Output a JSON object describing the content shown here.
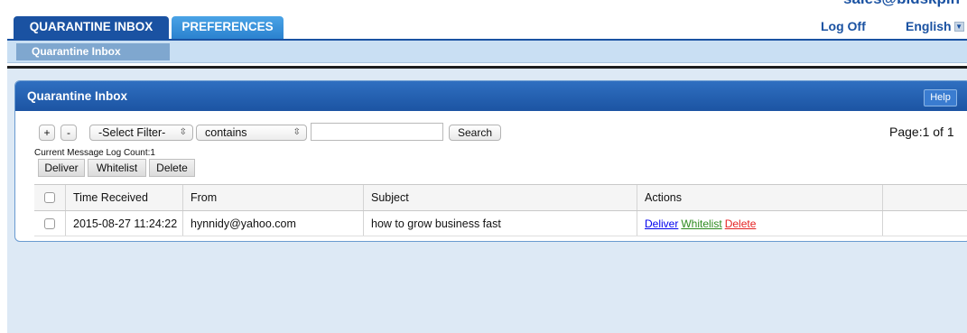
{
  "header": {
    "tabs": [
      {
        "label": "QUARANTINE INBOX",
        "active": true
      },
      {
        "label": "PREFERENCES",
        "active": false
      }
    ],
    "account_partial": "sales@bidskpin",
    "logoff_label": "Log Off",
    "language": "English"
  },
  "subnav": {
    "tab_label": "Quarantine Inbox"
  },
  "panel": {
    "title": "Quarantine Inbox",
    "help_label": "Help",
    "add_label": "+",
    "remove_label": "-",
    "filter_select": "-Select Filter-",
    "condition_select": "contains",
    "search_value": "",
    "search_label": "Search",
    "page_info": "Page:1 of 1",
    "log_count": "Current Message Log Count:1",
    "buttons": [
      "Deliver",
      "Whitelist",
      "Delete"
    ]
  },
  "table": {
    "columns": [
      "Time Received",
      "From",
      "Subject",
      "Actions"
    ],
    "rows": [
      {
        "time": "2015-08-27 11:24:22",
        "from": "hynnidy@yahoo.com",
        "subject": "how to grow business fast",
        "actions": [
          "Deliver",
          "Whitelist",
          "Delete"
        ]
      }
    ]
  },
  "colors": {
    "brand_blue": "#1a52a2",
    "deliver_link": "#0000ee",
    "whitelist_link": "#2e8b1f",
    "delete_link": "#e52222"
  }
}
